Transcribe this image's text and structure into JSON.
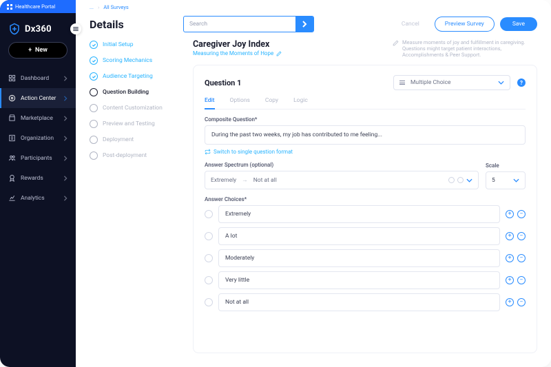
{
  "portal_label": "Healthcare Portal",
  "brand": "Dx360",
  "new_button": "New",
  "nav": [
    {
      "label": "Dashboard"
    },
    {
      "label": "Action Center"
    },
    {
      "label": "Marketplace"
    },
    {
      "label": "Organization"
    },
    {
      "label": "Participants"
    },
    {
      "label": "Rewards"
    },
    {
      "label": "Analytics"
    }
  ],
  "breadcrumb": {
    "parent": "...",
    "current": "All Surveys"
  },
  "page_title": "Details",
  "search_placeholder": "Search",
  "actions": {
    "cancel": "Cancel",
    "preview": "Preview Survey",
    "save": "Save"
  },
  "steps": [
    "Initial Setup",
    "Scoring Mechanics",
    "Audience Targeting",
    "Question Building",
    "Content Customization",
    "Preview and Testing",
    "Deployment",
    "Post-deployment"
  ],
  "survey": {
    "title": "Caregiver Joy Index",
    "subtitle": "Measuring the Moments of Hope",
    "description": "Measure moments of joy and fulfillment in caregiving. Questions might target patient interactions, Accomplishments & Peer Support."
  },
  "question": {
    "heading": "Question 1",
    "type": "Multiple Choice",
    "tabs": [
      "Edit",
      "Options",
      "Copy",
      "Logic"
    ],
    "composite_label": "Composite Question*",
    "composite_value": "During the past two weeks, my job has contributed to me feeling...",
    "switch_link": "Switch to single question format",
    "spectrum_label": "Answer Spectrum (optional)",
    "spectrum_from": "Extremely",
    "spectrum_to": "Not at all",
    "scale_label": "Scale",
    "scale_value": "5",
    "choices_label": "Answer Choices*",
    "choices": [
      "Extremely",
      "A lot",
      "Moderately",
      "Very little",
      "Not at all"
    ]
  }
}
